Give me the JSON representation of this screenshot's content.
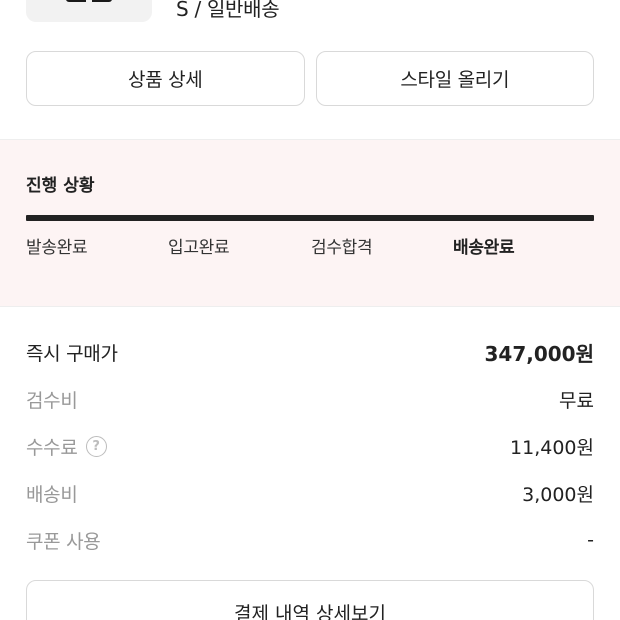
{
  "product": {
    "option_text": "S / 일반배송"
  },
  "actions": {
    "product_detail_label": "상품 상세",
    "style_upload_label": "스타일 올리기"
  },
  "progress": {
    "title": "진행 상황",
    "steps": [
      "발송완료",
      "입고완료",
      "검수합격",
      "배송완료"
    ],
    "current_step": "배송완료",
    "fill_fraction": 1.0
  },
  "pricing": {
    "rows": [
      {
        "label": "즉시 구매가",
        "value": "347,000원"
      },
      {
        "label": "검수비",
        "value": "무료"
      },
      {
        "label": "수수료",
        "value": "11,400원",
        "help_icon": "?"
      },
      {
        "label": "배송비",
        "value": "3,000원"
      },
      {
        "label": "쿠폰 사용",
        "value": "-"
      }
    ]
  },
  "footer": {
    "payment_detail_label": "결제 내역 상세보기"
  }
}
